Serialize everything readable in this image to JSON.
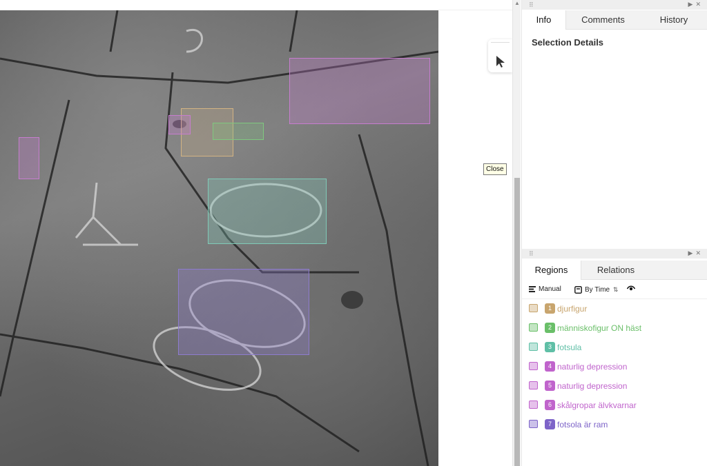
{
  "viewer": {
    "tooltip": "Close",
    "regions": [
      {
        "id": 1,
        "color": "#d4b483"
      },
      {
        "id": 2,
        "color": "#7fc97f"
      },
      {
        "id": 3,
        "color": "#80cbb8"
      },
      {
        "id": 4,
        "color": "#c77dcf"
      },
      {
        "id": 5,
        "color": "#c77dcf"
      },
      {
        "id": 6,
        "color": "#c77dcf"
      },
      {
        "id": 7,
        "color": "#8e7ccf"
      }
    ]
  },
  "info_panel": {
    "tabs": [
      "Info",
      "Comments",
      "History"
    ],
    "active_tab": "Info",
    "selection_title": "Selection Details"
  },
  "regions_panel": {
    "tabs": [
      "Regions",
      "Relations"
    ],
    "active_tab": "Regions",
    "toolbar": {
      "manual_label": "Manual",
      "by_time_label": "By Time",
      "sort_icon": "sort-asc-icon",
      "visibility_icon": "eye-icon"
    },
    "items": [
      {
        "num": "1",
        "label": "djurfigur",
        "color": "#c8a56e"
      },
      {
        "num": "2",
        "label": "människofigur ON häst",
        "color": "#6abf69"
      },
      {
        "num": "3",
        "label": "fotsula",
        "color": "#5fbfa6"
      },
      {
        "num": "4",
        "label": "naturlig depression",
        "color": "#c064cc"
      },
      {
        "num": "5",
        "label": "naturlig depression",
        "color": "#c064cc"
      },
      {
        "num": "6",
        "label": "skålgropar älvkvarnar",
        "color": "#c064cc"
      },
      {
        "num": "7",
        "label": "fotsola är ram",
        "color": "#7d63c8"
      }
    ]
  }
}
